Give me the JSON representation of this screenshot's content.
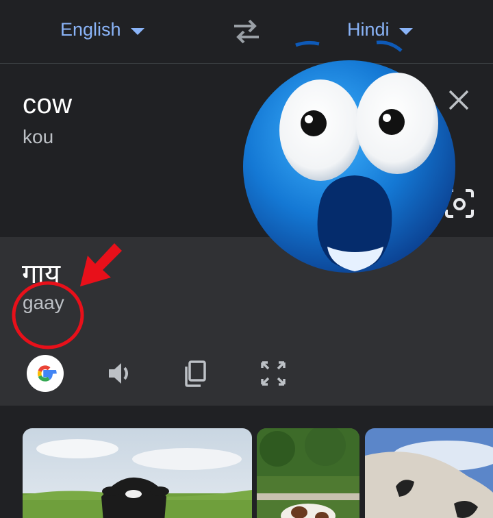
{
  "languages": {
    "source": "English",
    "target": "Hindi"
  },
  "input": {
    "text": "cow",
    "transliteration": "kou"
  },
  "output": {
    "text": "गाय",
    "transliteration": "gaay"
  },
  "icons": {
    "swap": "swap-arrows-icon",
    "close": "close-icon",
    "camera": "camera-icon",
    "google": "google-g-icon",
    "speak": "speaker-icon",
    "copy": "copy-icon",
    "expand": "fullscreen-icon"
  },
  "colors": {
    "accent": "#8ab4f8",
    "background": "#202124",
    "panel": "#303134",
    "annotation": "#e8101a"
  },
  "annotations": {
    "emoji": "shocked-face-emoji",
    "arrow": "red-arrow",
    "circle": "red-circle"
  }
}
